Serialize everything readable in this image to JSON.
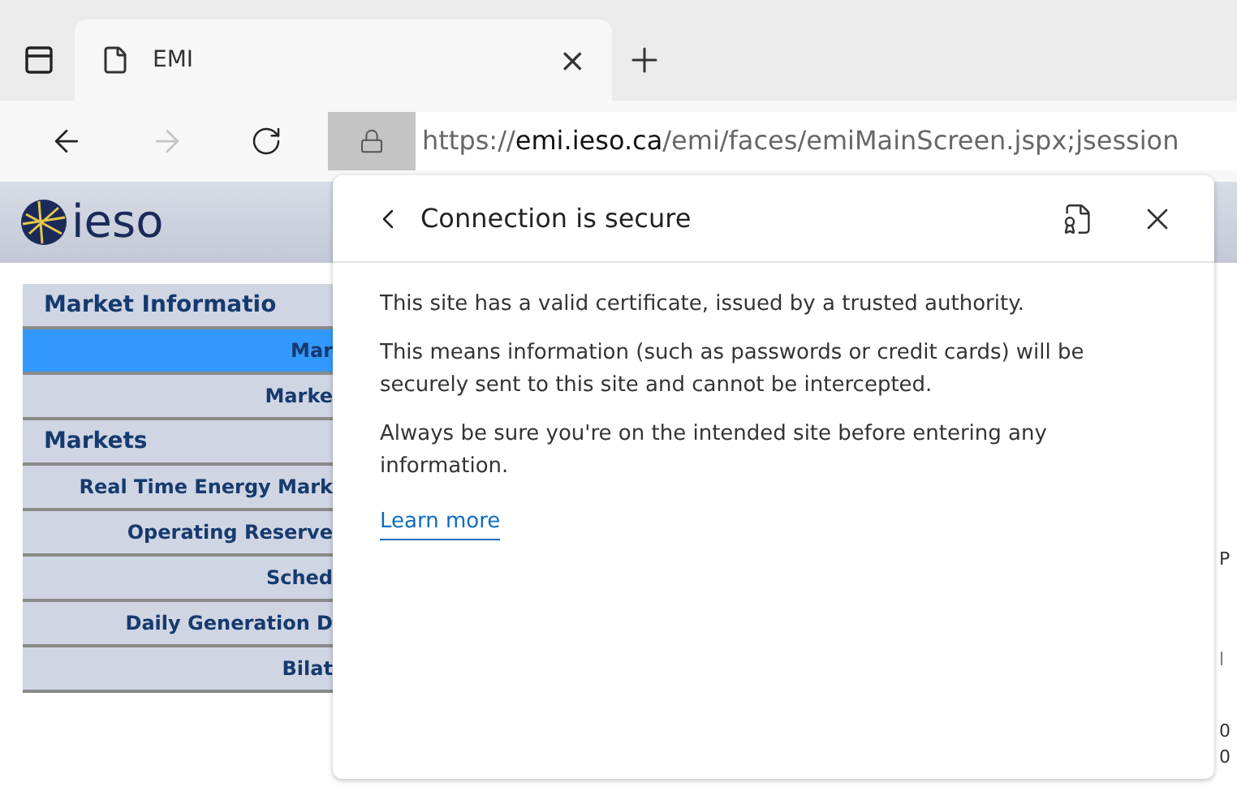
{
  "tabs": [
    {
      "title": "EMI",
      "selected": true,
      "close": "×"
    }
  ],
  "address_bar": {
    "url_prefix": "https://",
    "url_host": "emi.ieso.ca",
    "url_path": "/emi/faces/emiMainScreen.jspx;jsession"
  },
  "page": {
    "logo_text": "ieso",
    "sidebar": [
      {
        "kind": "header",
        "label": "Market Informatio",
        "selected": false
      },
      {
        "kind": "item",
        "label": "Mar",
        "selected": true
      },
      {
        "kind": "item",
        "label": "Marke",
        "selected": false
      },
      {
        "kind": "header",
        "label": "Markets",
        "selected": false
      },
      {
        "kind": "item",
        "label": "Real Time Energy Mark",
        "selected": false
      },
      {
        "kind": "item",
        "label": "Operating Reserve",
        "selected": false
      },
      {
        "kind": "item",
        "label": "Sched",
        "selected": false
      },
      {
        "kind": "item",
        "label": "Daily Generation D",
        "selected": false
      },
      {
        "kind": "item",
        "label": "Bilat",
        "selected": false
      }
    ],
    "right_edge_fragments": [
      "P",
      "l",
      "0",
      "0"
    ]
  },
  "popup": {
    "title": "Connection is secure",
    "paragraphs": [
      "This site has a valid certificate, issued by a trusted authority.",
      "This means information (such as passwords or credit cards) will be securely sent to this site and cannot be intercepted.",
      "Always be sure you're on the intended site before entering any information."
    ],
    "link": "Learn more"
  }
}
